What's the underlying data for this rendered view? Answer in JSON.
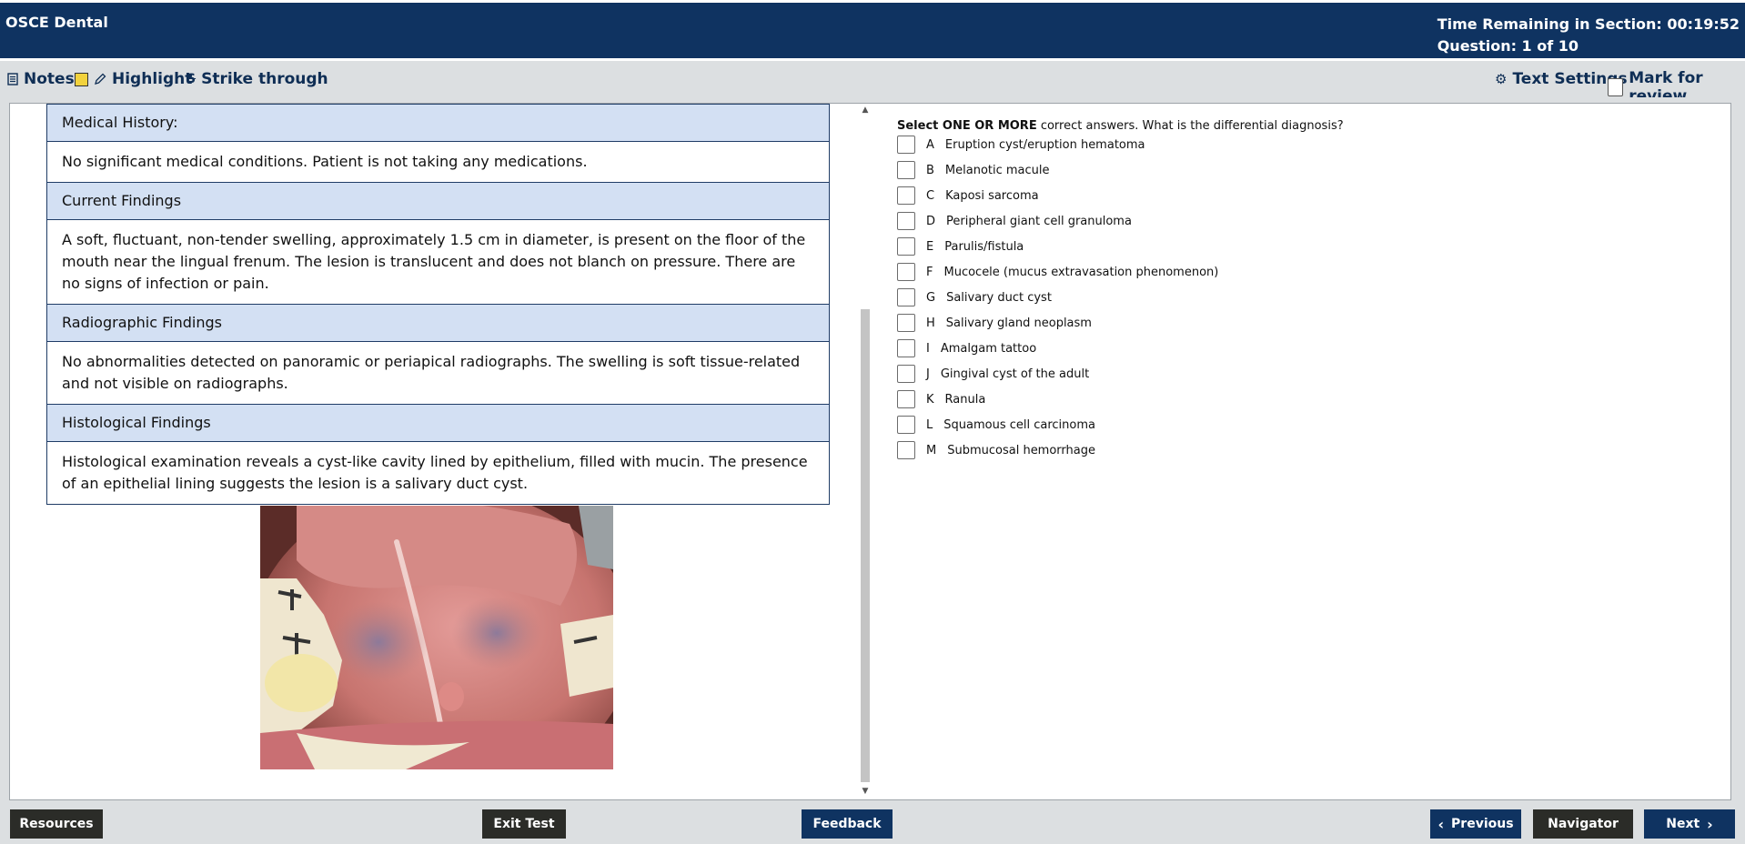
{
  "header": {
    "title": "OSCE Dental",
    "time_remaining": "Time Remaining in Section: 00:19:52",
    "question_counter": "Question: 1 of 10"
  },
  "toolbar": {
    "notes": "Notes",
    "highlight": "Highlight",
    "strike_through": "Strike through",
    "text_settings": "Text Settings",
    "mark_for_review": "Mark for review"
  },
  "case": {
    "rows": [
      {
        "type": "header",
        "text": "Medical History:"
      },
      {
        "type": "body",
        "text": "No significant medical conditions. Patient is not taking any medications."
      },
      {
        "type": "header",
        "text": "Current Findings"
      },
      {
        "type": "body",
        "text": "A soft, fluctuant, non-tender swelling, approximately 1.5 cm in diameter, is present on the floor of the mouth near the lingual frenum. The lesion is translucent and does not blanch on pressure. There are no signs of infection or pain."
      },
      {
        "type": "header",
        "text": "Radiographic Findings"
      },
      {
        "type": "body",
        "text": "No abnormalities detected on panoramic or periapical radiographs. The swelling is soft tissue-related and not visible on radiographs."
      },
      {
        "type": "header",
        "text": "Histological Findings"
      },
      {
        "type": "body",
        "text": "Histological examination reveals a cyst-like cavity lined by epithelium, filled with mucin. The presence of an epithelial lining suggests the lesion is a salivary duct cyst."
      }
    ]
  },
  "question": {
    "prefix_bold": "Select ONE OR MORE",
    "text": " correct answers. What is the differential diagnosis?",
    "options": [
      {
        "letter": "A",
        "text": "Eruption cyst/eruption hematoma"
      },
      {
        "letter": "B",
        "text": "Melanotic macule"
      },
      {
        "letter": "C",
        "text": "Kaposi sarcoma"
      },
      {
        "letter": "D",
        "text": "Peripheral giant cell granuloma"
      },
      {
        "letter": "E",
        "text": "Parulis/fistula"
      },
      {
        "letter": "F",
        "text": "Mucocele (mucus extravasation phenomenon)"
      },
      {
        "letter": "G",
        "text": "Salivary duct cyst"
      },
      {
        "letter": "H",
        "text": "Salivary gland neoplasm"
      },
      {
        "letter": "I",
        "text": "Amalgam tattoo"
      },
      {
        "letter": "J",
        "text": "Gingival cyst of the adult"
      },
      {
        "letter": "K",
        "text": "Ranula"
      },
      {
        "letter": "L",
        "text": "Squamous cell carcinoma"
      },
      {
        "letter": "M",
        "text": "Submucosal hemorrhage"
      }
    ]
  },
  "footer": {
    "resources": "Resources",
    "exit_test": "Exit Test",
    "feedback": "Feedback",
    "previous": "Previous",
    "navigator": "Navigator",
    "next": "Next"
  }
}
